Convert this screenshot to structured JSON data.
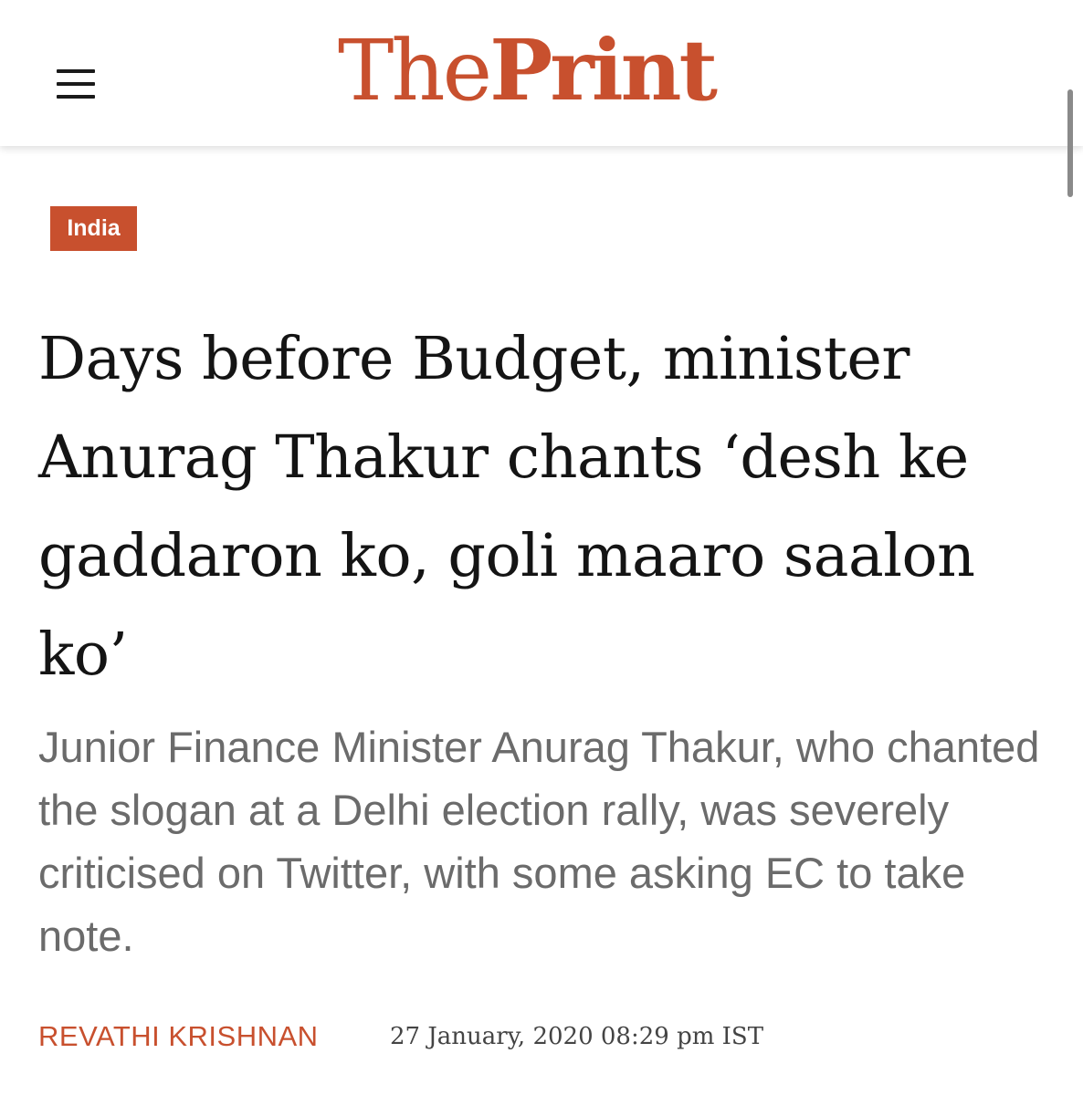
{
  "header": {
    "menu_icon": "hamburger-menu-icon",
    "logo_the": "The",
    "logo_print": "Print"
  },
  "article": {
    "category": "India",
    "headline": "Days before Budget, minister Anurag Thakur chants ‘desh ke gaddaron ko, goli maaro saalon ko’",
    "subheadline": "Junior Finance Minister Anurag Thakur, who chanted the slogan at a Delhi election rally, was severely criticised on Twitter, with some asking EC to take note.",
    "author": "REVATHI KRISHNAN",
    "date": "27 January, 2020 08:29 pm IST"
  },
  "colors": {
    "brand": "#c8502e",
    "headline_text": "#141414",
    "subhead_text": "#6b6b6b",
    "date_text": "#444444"
  }
}
